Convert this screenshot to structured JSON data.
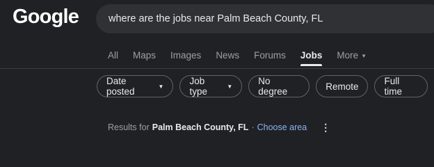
{
  "logo": {
    "text": "Google"
  },
  "search": {
    "query": "where are the jobs near Palm Beach County, FL"
  },
  "tabs": [
    {
      "label": "All"
    },
    {
      "label": "Maps"
    },
    {
      "label": "Images"
    },
    {
      "label": "News"
    },
    {
      "label": "Forums"
    },
    {
      "label": "Jobs",
      "active": true
    },
    {
      "label": "More",
      "icon": "caret-down-icon"
    }
  ],
  "chips": [
    {
      "label": "Date posted",
      "icon": "caret-down-icon"
    },
    {
      "label": "Job type",
      "icon": "caret-down-icon"
    },
    {
      "label": "No degree"
    },
    {
      "label": "Remote"
    },
    {
      "label": "Full time"
    }
  ],
  "results": {
    "prefix": "Results for",
    "location": "Palm Beach County, FL",
    "separator": "·",
    "link": "Choose area",
    "menu_icon": "more-vert-icon"
  },
  "colors": {
    "background": "#202124",
    "search_bg": "#303134",
    "link": "#8ab4f8",
    "muted_text": "#9aa0a6"
  }
}
